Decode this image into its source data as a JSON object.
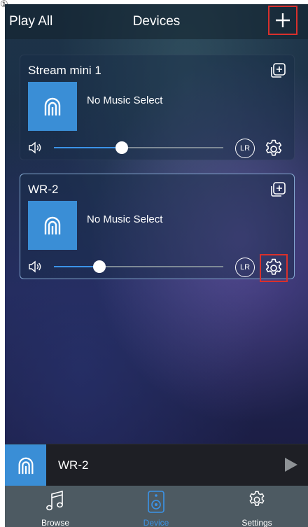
{
  "corner_mark": "①",
  "header": {
    "play_all": "Play All",
    "title": "Devices"
  },
  "devices": [
    {
      "name": "Stream mini 1",
      "track": "No Music Select",
      "volume_fraction": 0.4,
      "lr_label": "LR"
    },
    {
      "name": "WR-2",
      "track": "No Music Select",
      "volume_fraction": 0.27,
      "lr_label": "LR"
    }
  ],
  "now_playing": {
    "name": "WR-2"
  },
  "tabs": [
    {
      "label": "Browse",
      "icon": "music-note-icon",
      "active": false
    },
    {
      "label": "Device",
      "icon": "speaker-icon",
      "active": true
    },
    {
      "label": "Settings",
      "icon": "gear-icon",
      "active": false
    }
  ],
  "colors": {
    "accent": "#3b93e8",
    "album_art": "#3a8ed6",
    "highlight": "#d9302c",
    "tabbar": "#4d5a62"
  }
}
